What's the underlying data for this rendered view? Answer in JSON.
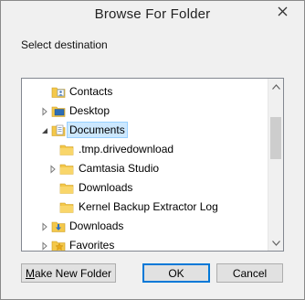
{
  "window": {
    "title": "Browse For Folder"
  },
  "prompt": "Select destination",
  "tree": {
    "items": [
      {
        "label": "Contacts",
        "icon": "contacts-folder-icon",
        "expander": "none",
        "selected": false
      },
      {
        "label": "Desktop",
        "icon": "desktop-folder-icon",
        "expander": "collapsed",
        "selected": false
      },
      {
        "label": "Documents",
        "icon": "documents-folder-icon",
        "expander": "expanded",
        "selected": true
      },
      {
        "label": ".tmp.drivedownload",
        "icon": "folder-icon",
        "expander": "none",
        "selected": false
      },
      {
        "label": "Camtasia Studio",
        "icon": "folder-icon",
        "expander": "collapsed",
        "selected": false
      },
      {
        "label": "Downloads",
        "icon": "folder-icon",
        "expander": "none",
        "selected": false
      },
      {
        "label": "Kernel Backup Extractor Log",
        "icon": "folder-icon",
        "expander": "none",
        "selected": false
      },
      {
        "label": "Downloads",
        "icon": "downloads-folder-icon",
        "expander": "collapsed",
        "selected": false
      },
      {
        "label": "Favorites",
        "icon": "favorites-folder-icon",
        "expander": "collapsed",
        "selected": false
      }
    ]
  },
  "buttons": {
    "make_new_folder_prefix": "M",
    "make_new_folder_rest": "ake New Folder",
    "ok": "OK",
    "cancel": "Cancel"
  },
  "colors": {
    "selection_bg": "#cce8ff",
    "selection_border": "#99d1ff",
    "folder_yellow": "#f4c84a",
    "default_button_border": "#0078d7"
  }
}
